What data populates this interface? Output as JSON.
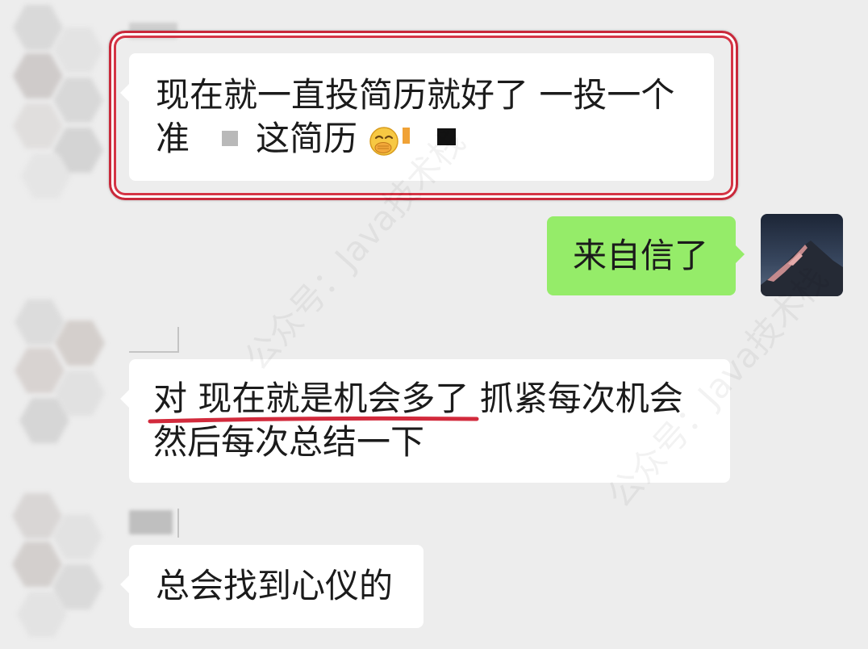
{
  "theme": {
    "background": "#ededed",
    "bubble_in": "#ffffff",
    "bubble_out": "#95ec69",
    "highlight": "#d0283c"
  },
  "watermark": "公众号：Java技术栈",
  "messages": {
    "m1": {
      "line1": "现在就一直投简历就好了 一投一个",
      "line2_start": "准",
      "line2_mid": "这简历",
      "emoji": "face-with-hand-over-mouth-emoji"
    },
    "m2": {
      "text": "来自信了"
    },
    "m3": {
      "line1": "对 现在就是机会多了 抓紧每次机会",
      "line2": "然后每次总结一下"
    },
    "m4": {
      "text": "总会找到心仪的"
    }
  }
}
